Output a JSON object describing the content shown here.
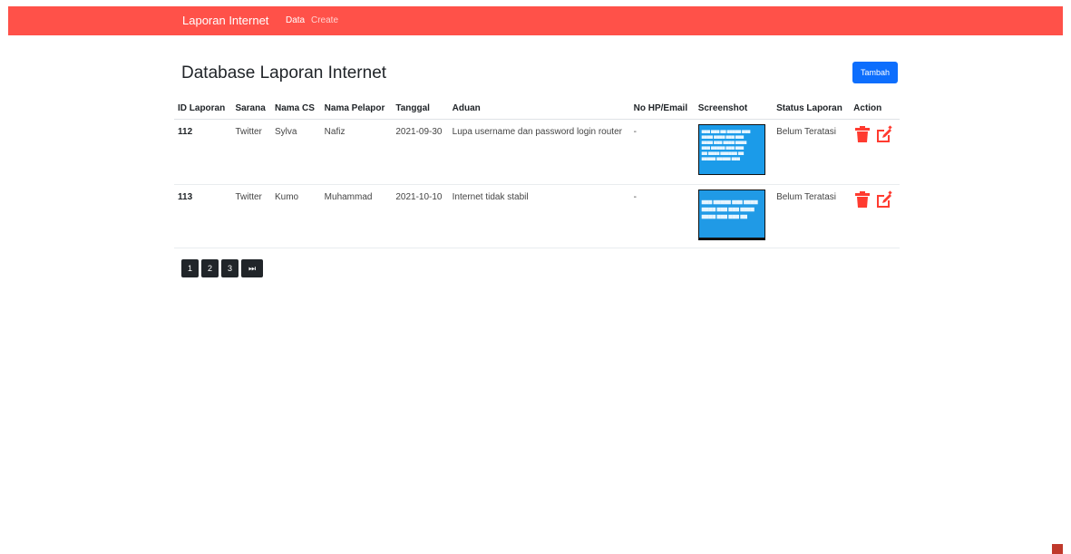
{
  "navbar": {
    "brand": "Laporan Internet",
    "links": [
      "Data",
      "Create"
    ]
  },
  "page": {
    "title": "Database Laporan Internet",
    "add_button": "Tambah"
  },
  "table": {
    "headers": [
      "ID Laporan",
      "Sarana",
      "Nama CS",
      "Nama Pelapor",
      "Tanggal",
      "Aduan",
      "No HP/Email",
      "Screenshot",
      "Status Laporan",
      "Action"
    ],
    "rows": [
      {
        "id": "112",
        "sarana": "Twitter",
        "nama_cs": "Sylva",
        "nama_pelapor": "Nafiz",
        "tanggal": "2021-09-30",
        "aduan": "Lupa username dan password login router",
        "kontak": "-",
        "status": "Belum Teratasi"
      },
      {
        "id": "113",
        "sarana": "Twitter",
        "nama_cs": "Kumo",
        "nama_pelapor": "Muhammad",
        "tanggal": "2021-10-10",
        "aduan": "Internet tidak stabil",
        "kontak": "-",
        "status": "Belum Teratasi"
      }
    ]
  },
  "pagination": {
    "pages": [
      "1",
      "2",
      "3"
    ],
    "last_icon": "⏭"
  },
  "colors": {
    "navbar": "#ff5149",
    "primary": "#0d6efd",
    "delete_icon": "#ff3b30",
    "edit_icon": "#ff3b30",
    "page_button": "#212529"
  },
  "icons": [
    "trash-icon",
    "edit-icon",
    "skip-last-icon"
  ]
}
